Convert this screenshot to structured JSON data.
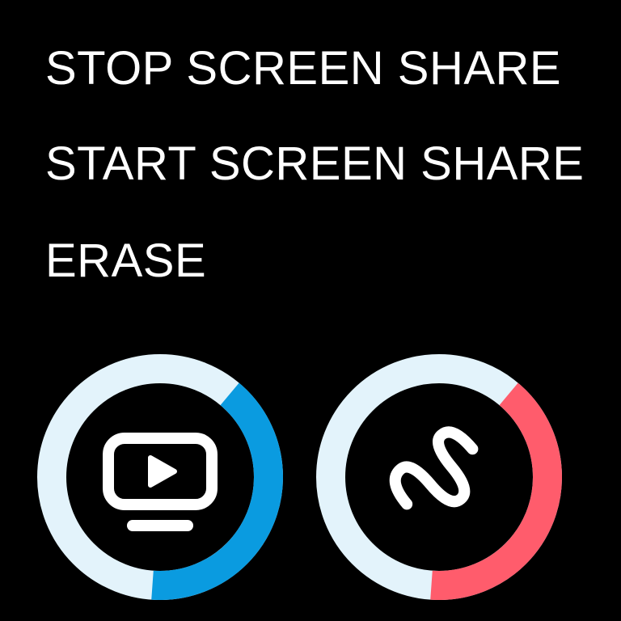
{
  "menu": {
    "items": [
      {
        "label": "STOP SCREEN SHARE"
      },
      {
        "label": "START SCREEN SHARE"
      },
      {
        "label": "ERASE"
      }
    ]
  },
  "dials": [
    {
      "icon": "screen-share-icon",
      "progress_fraction": 0.4,
      "track_color": "#e3f3fb",
      "progress_color": "#0a9be0"
    },
    {
      "icon": "scribble-erase-icon",
      "progress_fraction": 0.4,
      "track_color": "#e3f3fb",
      "progress_color": "#ff5c6c"
    }
  ],
  "colors": {
    "background": "#000000",
    "text": "#ffffff",
    "icon": "#ffffff"
  }
}
